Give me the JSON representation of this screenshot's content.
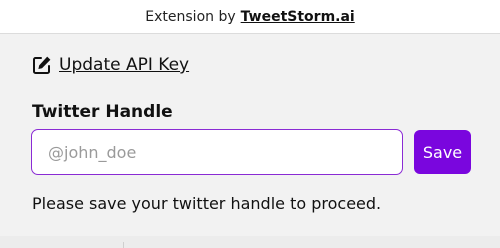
{
  "header": {
    "prefix": "Extension by",
    "brand": "TweetStorm.ai"
  },
  "api_key_link": {
    "icon": "edit-icon",
    "label": "Update API Key"
  },
  "form": {
    "label": "Twitter Handle",
    "input_value": "",
    "input_placeholder": "@john_doe",
    "save_label": "Save",
    "hint": "Please save your twitter handle to proceed."
  },
  "colors": {
    "accent": "#7a06de",
    "input_border": "#8a2bd4"
  }
}
